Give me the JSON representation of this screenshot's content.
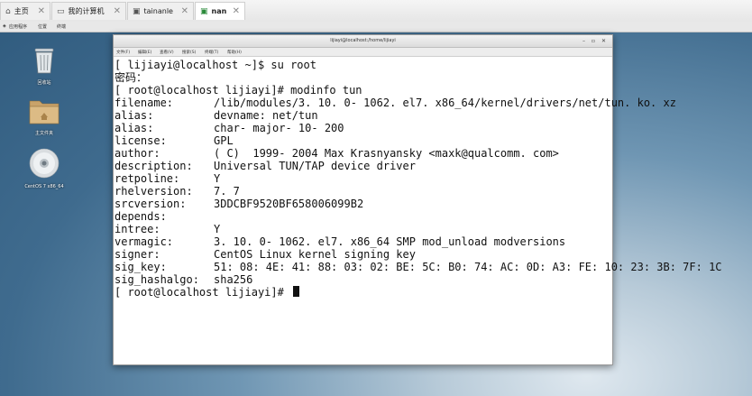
{
  "tabs": [
    {
      "label": "主页",
      "icon": "home-icon"
    },
    {
      "label": "我的计算机",
      "icon": "computer-icon"
    },
    {
      "label": "tainanle",
      "icon": "vm-icon"
    },
    {
      "label": "nan",
      "icon": "vm-icon",
      "active": true
    }
  ],
  "menubar": {
    "apps": "应用程序",
    "places": "位置",
    "terminal": "终端"
  },
  "desktop": [
    {
      "label": "回收站",
      "icon": "trash-icon"
    },
    {
      "label": "主文件夹",
      "icon": "folder-icon"
    },
    {
      "label": "CentOS 7 x86_64",
      "icon": "disc-icon"
    }
  ],
  "window": {
    "title": "lijiayi@localhost:/home/lijiayi",
    "menu": [
      "文件(F)",
      "编辑(E)",
      "查看(V)",
      "搜索(S)",
      "终端(T)",
      "帮助(H)"
    ]
  },
  "terminal": {
    "prompt1": "[ lijiayi@localhost ~]$ su root",
    "password": "密码：",
    "prompt2": "[ root@localhost lijiayi]# modinfo tun",
    "rows": [
      {
        "key": "filename:",
        "value": "/lib/modules/3. 10. 0- 1062. el7. x86_64/kernel/drivers/net/tun. ko. xz"
      },
      {
        "key": "alias:",
        "value": "devname: net/tun"
      },
      {
        "key": "alias:",
        "value": "char- major- 10- 200"
      },
      {
        "key": "license:",
        "value": "GPL"
      },
      {
        "key": "author:",
        "value": "( C)  1999- 2004 Max Krasnyansky <maxk@qualcomm. com>"
      },
      {
        "key": "description:",
        "value": "Universal TUN/TAP device driver"
      },
      {
        "key": "retpoline:",
        "value": "Y"
      },
      {
        "key": "rhelversion:",
        "value": "7. 7"
      },
      {
        "key": "srcversion:",
        "value": "3DDCBF9520BF658006099B2"
      },
      {
        "key": "depends:",
        "value": ""
      },
      {
        "key": "intree:",
        "value": "Y"
      },
      {
        "key": "vermagic:",
        "value": "3. 10. 0- 1062. el7. x86_64 SMP mod_unload modversions"
      },
      {
        "key": "signer:",
        "value": "CentOS Linux kernel signing key"
      },
      {
        "key": "sig_key:",
        "value": "51: 08: 4E: 41: 88: 03: 02: BE: 5C: B0: 74: AC: 0D: A3: FE: 10: 23: 3B: 7F: 1C"
      },
      {
        "key": "sig_hashalgo:",
        "value": "sha256"
      }
    ],
    "prompt3": "[ root@localhost lijiayi]# "
  }
}
